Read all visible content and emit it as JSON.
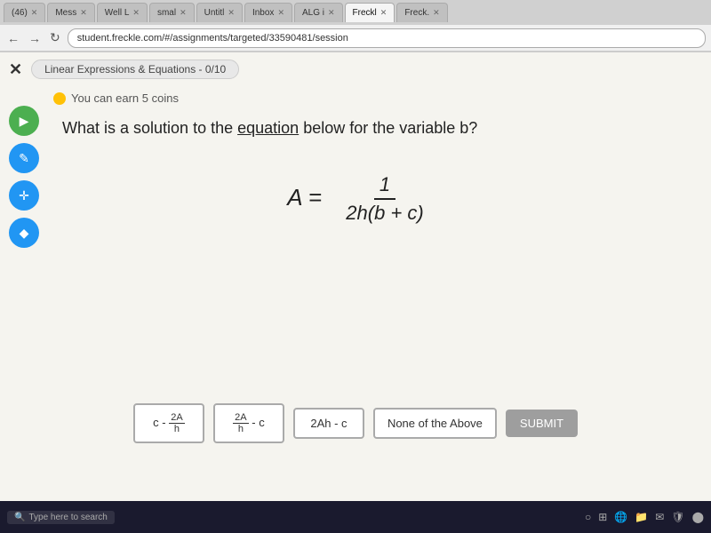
{
  "browser": {
    "tabs": [
      {
        "label": "(46)",
        "active": false
      },
      {
        "label": "Mess",
        "active": false
      },
      {
        "label": "Well L",
        "active": false
      },
      {
        "label": "smal",
        "active": false
      },
      {
        "label": "Untitl",
        "active": false
      },
      {
        "label": "Inbox",
        "active": false
      },
      {
        "label": "ALG i",
        "active": false
      },
      {
        "label": "Freckl",
        "active": true
      },
      {
        "label": "Freck.",
        "active": false
      }
    ],
    "address": "student.freckle.com/#/assignments/targeted/33590481/session",
    "back_label": "←",
    "forward_label": "→",
    "refresh_label": "↻"
  },
  "topbar": {
    "close_label": "✕",
    "breadcrumb": "Linear Expressions & Equations - 0/10"
  },
  "sidebar": {
    "icons": [
      {
        "name": "play",
        "symbol": "▶"
      },
      {
        "name": "pencil",
        "symbol": "✎"
      },
      {
        "name": "move",
        "symbol": "✛"
      },
      {
        "name": "eraser",
        "symbol": "◆"
      }
    ]
  },
  "coins": {
    "notice": "You can earn 5 coins"
  },
  "question": {
    "text": "What is a solution to the equation below for the variable b?",
    "underline_word": "equation",
    "equation_lhs": "A =",
    "numerator": "1",
    "denominator": "2h(b + c)"
  },
  "answers": [
    {
      "id": "a",
      "label": "c - 2A/h",
      "display_type": "fraction",
      "prefix": "c - ",
      "num": "2A",
      "den": "h"
    },
    {
      "id": "b",
      "label": "2A/h - c",
      "display_type": "fraction",
      "num": "2A",
      "den": "h",
      "suffix": " - c"
    },
    {
      "id": "c",
      "label": "2Ah - c",
      "display_type": "text"
    },
    {
      "id": "d",
      "label": "None of the Above",
      "display_type": "text"
    }
  ],
  "submit": {
    "label": "SUBMIT"
  },
  "taskbar": {
    "search_placeholder": "Type here to search"
  }
}
